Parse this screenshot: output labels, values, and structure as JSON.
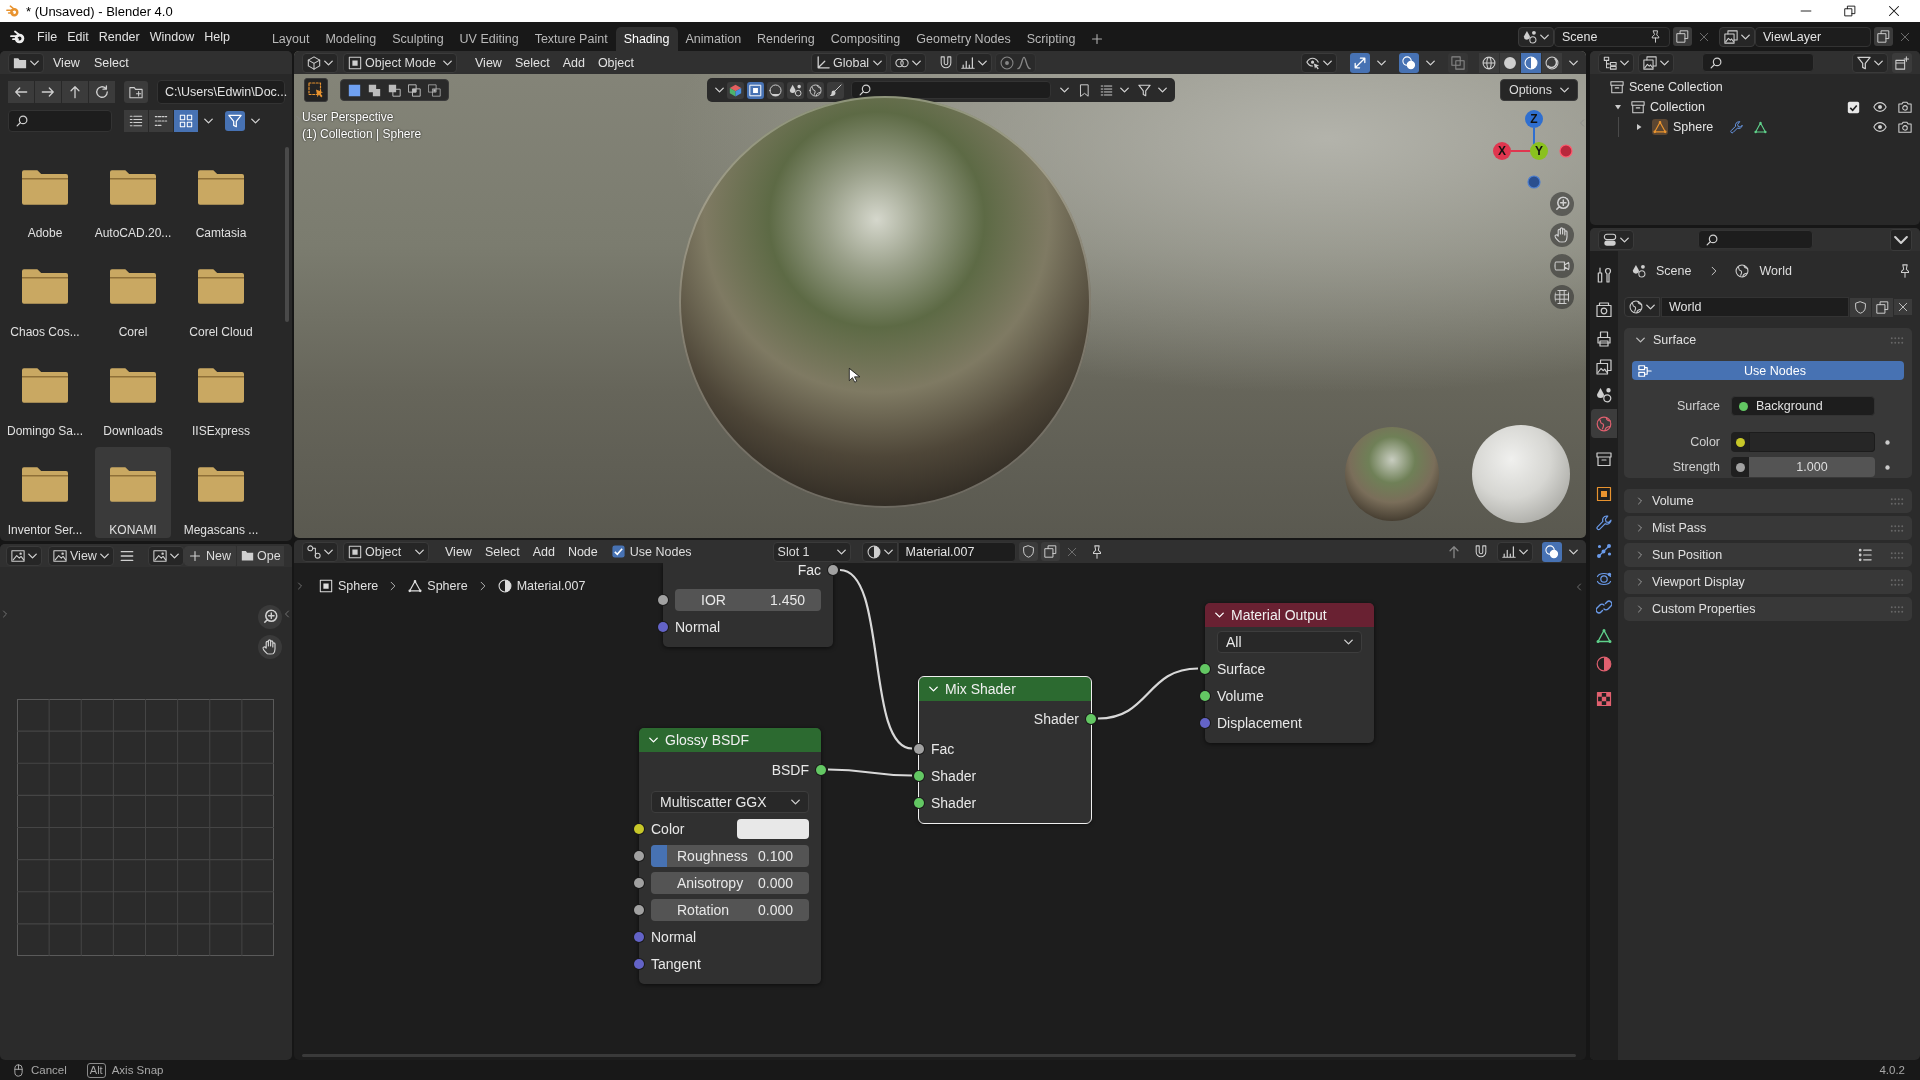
{
  "window": {
    "title": "* (Unsaved) - Blender 4.0"
  },
  "top_bar": {
    "menus": [
      "File",
      "Edit",
      "Render",
      "Window",
      "Help"
    ],
    "workspaces": [
      {
        "label": "Layout",
        "selected": false
      },
      {
        "label": "Modeling",
        "selected": false
      },
      {
        "label": "Sculpting",
        "selected": false
      },
      {
        "label": "UV Editing",
        "selected": false
      },
      {
        "label": "Texture Paint",
        "selected": false
      },
      {
        "label": "Shading",
        "selected": true
      },
      {
        "label": "Animation",
        "selected": false
      },
      {
        "label": "Rendering",
        "selected": false
      },
      {
        "label": "Compositing",
        "selected": false
      },
      {
        "label": "Geometry Nodes",
        "selected": false
      },
      {
        "label": "Scripting",
        "selected": false
      }
    ],
    "scene": "Scene",
    "view_layer": "ViewLayer"
  },
  "file_browser": {
    "menus": [
      "View",
      "Select"
    ],
    "path": "C:\\Users\\Edwin\\Doc...",
    "display_modes": [
      {
        "kind": "list",
        "selected": false
      },
      {
        "kind": "short_list",
        "selected": false
      },
      {
        "kind": "thumbnails",
        "selected": true
      }
    ],
    "filter_on": true,
    "folders": [
      {
        "name": "Adobe",
        "selected": false
      },
      {
        "name": "AutoCAD.20...",
        "selected": false
      },
      {
        "name": "Camtasia",
        "selected": false
      },
      {
        "name": "Chaos Cos...",
        "selected": false
      },
      {
        "name": "Corel",
        "selected": false
      },
      {
        "name": "Corel Cloud",
        "selected": false
      },
      {
        "name": "Domingo Sa...",
        "selected": false
      },
      {
        "name": "Downloads",
        "selected": false
      },
      {
        "name": "IISExpress",
        "selected": false
      },
      {
        "name": "Inventor Ser...",
        "selected": false
      },
      {
        "name": "KONAMI",
        "selected": true
      },
      {
        "name": "Megascans ...",
        "selected": false
      }
    ]
  },
  "image_editor": {
    "view_menu": "View",
    "new_button": "New",
    "open_button": "Ope"
  },
  "viewport": {
    "mode": "Object Mode",
    "menus": [
      "View",
      "Select",
      "Add",
      "Object"
    ],
    "orientation": "Global",
    "gizmos_on": true,
    "overlays_on": true,
    "shading_modes": [
      {
        "kind": "wireframe",
        "selected": false
      },
      {
        "kind": "solid",
        "selected": false
      },
      {
        "kind": "material",
        "selected": true
      },
      {
        "kind": "rendered",
        "selected": false
      }
    ],
    "selection_modes": [
      {
        "kind": "set",
        "selected": true
      },
      {
        "kind": "extend",
        "selected": false
      },
      {
        "kind": "subtract",
        "selected": false
      },
      {
        "kind": "invert",
        "selected": false
      },
      {
        "kind": "intersect",
        "selected": false
      }
    ],
    "toolbar_icons": [
      {
        "kind": "color_cube",
        "selected": false
      },
      {
        "kind": "square",
        "selected": true
      },
      {
        "kind": "sphere",
        "selected": false
      },
      {
        "kind": "shapes",
        "selected": false
      },
      {
        "kind": "globe",
        "selected": false
      },
      {
        "kind": "brush",
        "selected": false
      }
    ],
    "options_button": "Options",
    "perspective": "User Perspective",
    "context": "(1) Collection | Sphere",
    "axes": [
      {
        "label": "Z",
        "color": "#2f6fd0"
      },
      {
        "label": "X",
        "color": "#e0364f"
      },
      {
        "label": "Y",
        "color": "#8ac11f"
      }
    ]
  },
  "node_editor": {
    "object_type": "Object",
    "menus": [
      "View",
      "Select",
      "Add",
      "Node"
    ],
    "use_nodes": {
      "label": "Use Nodes",
      "checked": true
    },
    "slot": "Slot 1",
    "material": "Material.007",
    "overlays_on": true,
    "breadcrumbs": [
      "Sphere",
      "Sphere",
      "Material.007"
    ],
    "nodes": [
      {
        "kind": "partial",
        "selected": false,
        "rows": [
          {
            "kind": "output",
            "label": "Fac",
            "socket": {
              "kind": "float"
            }
          },
          {
            "kind": "field",
            "label": "IOR",
            "value": "1.450",
            "socket": {
              "kind": "float"
            }
          },
          {
            "kind": "input",
            "label": "Normal",
            "socket": {
              "kind": "vector"
            }
          }
        ]
      },
      {
        "kind": "shader",
        "title": "Glossy BSDF",
        "selected": false,
        "rows": [
          {
            "kind": "output",
            "label": "BSDF",
            "socket": {
              "kind": "shader"
            }
          },
          {
            "kind": "dropdown",
            "value": "Multiscatter GGX"
          },
          {
            "kind": "color",
            "label": "Color",
            "socket": {
              "kind": "color"
            },
            "color": "#e8e8e8"
          },
          {
            "kind": "slider",
            "label": "Roughness",
            "value": "0.100",
            "level": 0.1,
            "socket": {
              "kind": "float"
            }
          },
          {
            "kind": "field",
            "label": "Anisotropy",
            "value": "0.000",
            "socket": {
              "kind": "float"
            }
          },
          {
            "kind": "field",
            "label": "Rotation",
            "value": "0.000",
            "socket": {
              "kind": "float"
            }
          },
          {
            "kind": "input",
            "label": "Normal",
            "socket": {
              "kind": "vector"
            }
          },
          {
            "kind": "input",
            "label": "Tangent",
            "socket": {
              "kind": "vector"
            }
          }
        ]
      },
      {
        "kind": "shader",
        "title": "Mix Shader",
        "selected": true,
        "rows": [
          {
            "kind": "output",
            "label": "Shader",
            "socket": {
              "kind": "shader"
            }
          },
          {
            "kind": "input",
            "label": "Fac",
            "socket": {
              "kind": "float"
            }
          },
          {
            "kind": "input",
            "label": "Shader",
            "socket": {
              "kind": "shader"
            }
          },
          {
            "kind": "input",
            "label": "Shader",
            "socket": {
              "kind": "shader"
            }
          }
        ]
      },
      {
        "kind": "output",
        "title": "Material Output",
        "selected": false,
        "rows": [
          {
            "kind": "dropdown",
            "value": "All"
          },
          {
            "kind": "input",
            "label": "Surface",
            "socket": {
              "kind": "shader"
            }
          },
          {
            "kind": "input",
            "label": "Volume",
            "socket": {
              "kind": "shader"
            }
          },
          {
            "kind": "input",
            "label": "Displacement",
            "socket": {
              "kind": "vector"
            }
          }
        ]
      }
    ]
  },
  "outliner": {
    "items": [
      {
        "label": "Scene Collection",
        "kind": "scene_collection",
        "children": [
          {
            "label": "Collection",
            "kind": "collection",
            "expanded": true,
            "checked": true,
            "children": [
              {
                "label": "Sphere",
                "kind": "mesh_object",
                "expanded": false
              }
            ]
          }
        ]
      }
    ]
  },
  "properties": {
    "tabs": [
      {
        "kind": "tool",
        "selected": false
      },
      {
        "kind": "render",
        "selected": false
      },
      {
        "kind": "output",
        "selected": false
      },
      {
        "kind": "view_layer",
        "selected": false
      },
      {
        "kind": "scene",
        "selected": false
      },
      {
        "kind": "world",
        "selected": true
      },
      {
        "kind": "collection",
        "selected": false
      },
      {
        "kind": "object",
        "selected": false
      },
      {
        "kind": "modifiers",
        "selected": false
      },
      {
        "kind": "particles",
        "selected": false
      },
      {
        "kind": "physics",
        "selected": false
      },
      {
        "kind": "constraints",
        "selected": false
      },
      {
        "kind": "data",
        "selected": false
      },
      {
        "kind": "material",
        "selected": false
      },
      {
        "kind": "texture",
        "selected": false
      }
    ],
    "breadcrumbs": [
      "Scene",
      "World"
    ],
    "datablock": "World",
    "panels": [
      {
        "title": "Surface",
        "expanded": true,
        "presets": false,
        "use_nodes": {
          "label": "Use Nodes",
          "on": true
        },
        "rows": [
          {
            "kind": "link",
            "label": "Surface",
            "value": "Background",
            "socket": {
              "kind": "shader"
            }
          },
          {
            "kind": "color",
            "label": "Color",
            "socket": {
              "kind": "color"
            },
            "color": "#262626"
          },
          {
            "kind": "number",
            "label": "Strength",
            "value": "1.000",
            "socket": {
              "kind": "float"
            }
          }
        ]
      },
      {
        "title": "Volume",
        "expanded": false,
        "presets": false
      },
      {
        "title": "Mist Pass",
        "expanded": false,
        "presets": false
      },
      {
        "title": "Sun Position",
        "expanded": false,
        "presets": true
      },
      {
        "title": "Viewport Display",
        "expanded": false,
        "presets": false
      },
      {
        "title": "Custom Properties",
        "expanded": false,
        "presets": false
      }
    ]
  },
  "status_bar": {
    "hints": [
      {
        "kind": "mouse",
        "label": "Cancel"
      },
      {
        "kind": "key",
        "key": "Alt",
        "label": "Axis Snap"
      }
    ],
    "version": "4.0.2"
  }
}
